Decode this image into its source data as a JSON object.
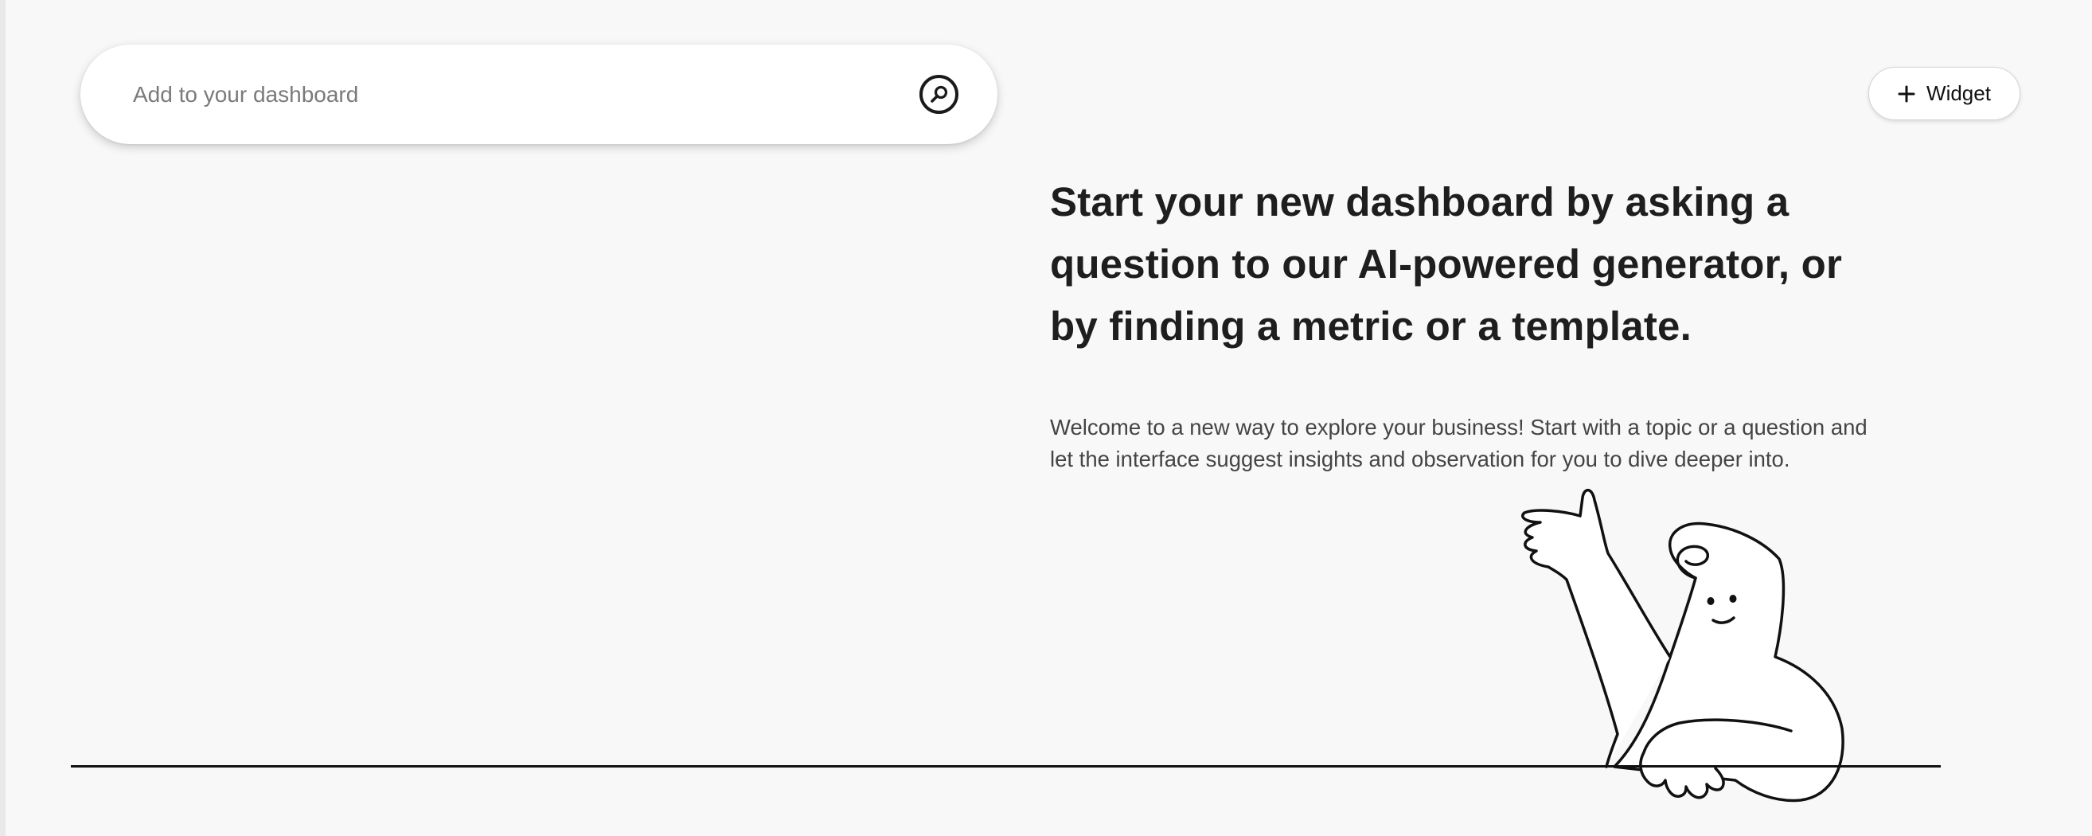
{
  "search": {
    "placeholder": "Add to your dashboard",
    "button_icon": "search-icon"
  },
  "toolbar": {
    "widget_label": "Widget",
    "widget_icon": "plus-icon"
  },
  "empty_state": {
    "headline": "Start your new dashboard by asking a question to our AI-powered generator, or by finding a metric or a template.",
    "description": "Welcome to a new way to explore your business! Start with a topic or a question and let the interface suggest insights and observation for you to dive deeper into.",
    "illustration": "waving-character-illustration"
  },
  "colors": {
    "background": "#f8f8f8",
    "text_primary": "#1e1e1e",
    "text_secondary": "#444444",
    "placeholder": "#7a7a7a"
  }
}
